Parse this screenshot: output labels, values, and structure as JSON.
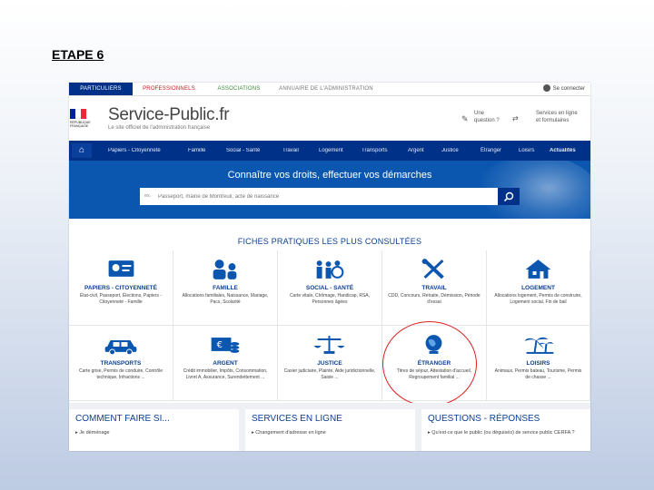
{
  "slide": {
    "title": "ETAPE 6"
  },
  "site": {
    "top_tabs": [
      "PARTICULIERS",
      "PROFESSIONNELS",
      "ASSOCIATIONS",
      "ANNUAIRE DE L'ADMINISTRATION"
    ],
    "login_label": "Se connecter",
    "rf_label": "RÉPUBLIQUE FRANÇAISE",
    "brand": "Service-Public.fr",
    "brand_sub": "Le site officiel de l'administration française",
    "header_links": {
      "question": [
        "Une",
        "question ?"
      ],
      "services": [
        "Services en ligne",
        "et formulaires"
      ]
    },
    "nav": [
      "Papiers - Citoyenneté",
      "Famille",
      "Social - Santé",
      "Travail",
      "Logement",
      "Transports",
      "Argent",
      "Justice",
      "Étranger",
      "Loisirs",
      "Actualités"
    ],
    "hero_title": "Connaître vos droits, effectuer vos démarches",
    "search": {
      "placeholder_prefix": "ex.",
      "placeholder": "Passeport, mairie de Montreuil, acte de naissance"
    },
    "fiches_title": "FICHES PRATIQUES LES PLUS CONSULTÉES",
    "tiles": [
      {
        "name": "PAPIERS - CITOYENNETÉ",
        "desc": "État-civil, Passeport, Élections, Papiers - Citoyenneté - Famille",
        "icon": "id-card-icon"
      },
      {
        "name": "FAMILLE",
        "desc": "Allocations familiales, Naissance, Mariage, Pacs, Scolarité",
        "icon": "family-icon"
      },
      {
        "name": "SOCIAL - SANTÉ",
        "desc": "Carte vitale, Chômage, Handicap, RSA, Personnes âgées",
        "icon": "health-icon"
      },
      {
        "name": "TRAVAIL",
        "desc": "CDD, Concours, Retraite, Démission, Période d'essai",
        "icon": "tools-icon"
      },
      {
        "name": "LOGEMENT",
        "desc": "Allocations logement, Permis de construire, Logement social, Fin de bail",
        "icon": "house-icon"
      },
      {
        "name": "TRANSPORTS",
        "desc": "Carte grise, Permis de conduire, Contrôle technique, Infractions ...",
        "icon": "car-icon"
      },
      {
        "name": "ARGENT",
        "desc": "Crédit immobilier, Impôts, Consommation, Livret A, Assurance, Surendettement ...",
        "icon": "money-icon"
      },
      {
        "name": "JUSTICE",
        "desc": "Casier judiciaire, Plainte, Aide juridictionnelle, Saisie ...",
        "icon": "scales-icon"
      },
      {
        "name": "ÉTRANGER",
        "desc": "Titres de séjour, Attestation d'accueil, Regroupement familial ...",
        "icon": "globe-icon"
      },
      {
        "name": "LOISIRS",
        "desc": "Animaux, Permis bateau, Tourisme, Permis de chasse ...",
        "icon": "palm-icon"
      }
    ],
    "bottom": [
      {
        "title": "COMMENT FAIRE SI...",
        "line": "▸ Je déménage"
      },
      {
        "title": "SERVICES EN LIGNE",
        "line": "▸ Changement d'adresse en ligne"
      },
      {
        "title": "QUESTIONS - RÉPONSES",
        "line": "▸ Qu'est-ce que le public (ou déguisés) de service public CERFA ?"
      }
    ]
  },
  "colors": {
    "navy": "#003189",
    "hero_blue": "#0b57b0",
    "tile_title": "#0b3f91",
    "highlight_ring": "#e02020"
  }
}
